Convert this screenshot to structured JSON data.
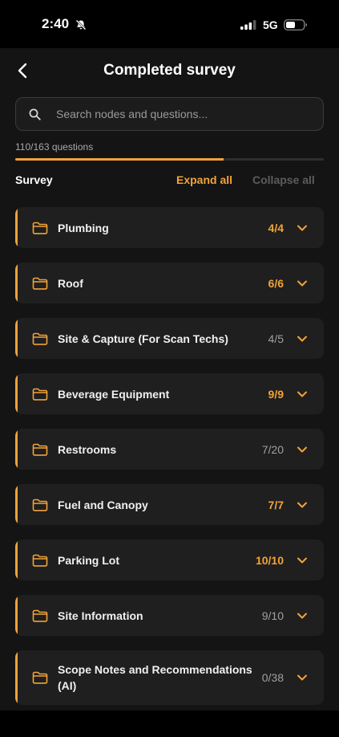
{
  "status_bar": {
    "time": "2:40",
    "network": "5G",
    "icons": [
      "bell-slash-icon",
      "signal-icon",
      "battery-icon"
    ]
  },
  "header": {
    "title": "Completed survey",
    "back_icon": "chevron-left-icon"
  },
  "search": {
    "placeholder": "Search nodes and questions..."
  },
  "progress": {
    "text": "110/163 questions",
    "answered": 110,
    "total": 163
  },
  "survey_bar": {
    "label": "Survey",
    "expand_all": "Expand all",
    "collapse_all": "Collapse all"
  },
  "colors": {
    "accent": "#f2a33a",
    "card": "#1f1f1f",
    "background": "#141414",
    "muted": "#a0a0a0",
    "disabled": "#5c5c5c"
  },
  "nodes": [
    {
      "name": "Plumbing",
      "count": "4/4",
      "complete": true
    },
    {
      "name": "Roof",
      "count": "6/6",
      "complete": true
    },
    {
      "name": "Site & Capture (For Scan Techs)",
      "count": "4/5",
      "complete": false
    },
    {
      "name": "Beverage Equipment",
      "count": "9/9",
      "complete": true
    },
    {
      "name": "Restrooms",
      "count": "7/20",
      "complete": false
    },
    {
      "name": "Fuel and Canopy",
      "count": "7/7",
      "complete": true
    },
    {
      "name": "Parking Lot",
      "count": "10/10",
      "complete": true
    },
    {
      "name": "Site Information",
      "count": "9/10",
      "complete": false
    },
    {
      "name": "Scope Notes and Recommendations (AI)",
      "count": "0/38",
      "complete": false
    }
  ]
}
